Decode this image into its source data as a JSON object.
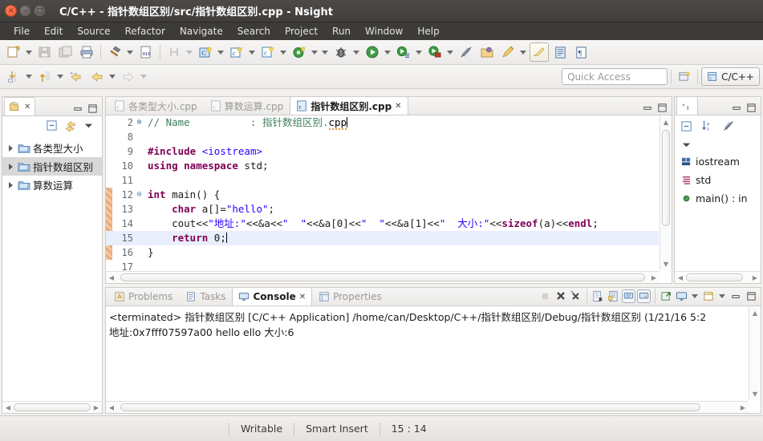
{
  "window": {
    "title": "C/C++ - 指针数组区别/src/指针数组区别.cpp - Nsight",
    "close_label": "✕",
    "minimize_label": "–",
    "maximize_label": "□"
  },
  "menubar": {
    "items": [
      {
        "label": "File"
      },
      {
        "label": "Edit"
      },
      {
        "label": "Source"
      },
      {
        "label": "Refactor"
      },
      {
        "label": "Navigate"
      },
      {
        "label": "Search"
      },
      {
        "label": "Project"
      },
      {
        "label": "Run"
      },
      {
        "label": "Window"
      },
      {
        "label": "Help"
      }
    ]
  },
  "toolbar": {
    "quick_access_placeholder": "Quick Access",
    "perspective_label": "C/C++"
  },
  "project_explorer": {
    "tab_label": "",
    "items": [
      {
        "label": "各类型大小",
        "selected": false
      },
      {
        "label": "指针数组区别",
        "selected": true
      },
      {
        "label": "算数运算",
        "selected": false
      }
    ]
  },
  "editor": {
    "tabs": [
      {
        "label": "各类型大小.cpp",
        "active": false
      },
      {
        "label": "算数运算.cpp",
        "active": false
      },
      {
        "label": "指针数组区别.cpp",
        "active": true,
        "close_label": "✕"
      }
    ],
    "lines": [
      {
        "num": "2",
        "fold": "⊕",
        "highlight": false,
        "changed": false,
        "tokens": [
          {
            "t": "// Name          : ",
            "c": "cmt"
          },
          {
            "t": "指针数组区别.",
            "c": "cmt-cn"
          },
          {
            "t": "cpp",
            "c": "spell"
          },
          {
            "t": "",
            "c": "caret"
          }
        ]
      },
      {
        "num": "8",
        "fold": "",
        "highlight": false,
        "changed": false,
        "tokens": []
      },
      {
        "num": "9",
        "fold": "",
        "highlight": false,
        "changed": false,
        "tokens": [
          {
            "t": "#include ",
            "c": "pre"
          },
          {
            "t": "<iostream>",
            "c": "inc"
          }
        ]
      },
      {
        "num": "10",
        "fold": "",
        "highlight": false,
        "changed": false,
        "tokens": [
          {
            "t": "using namespace ",
            "c": "kw"
          },
          {
            "t": "std;",
            "c": "plain"
          }
        ]
      },
      {
        "num": "11",
        "fold": "",
        "highlight": false,
        "changed": false,
        "tokens": []
      },
      {
        "num": "12",
        "fold": "⊖",
        "highlight": false,
        "changed": true,
        "tokens": [
          {
            "t": "int",
            "c": "kw"
          },
          {
            "t": " main() {",
            "c": "plain"
          }
        ]
      },
      {
        "num": "13",
        "fold": "",
        "highlight": false,
        "changed": true,
        "tokens": [
          {
            "t": "    ",
            "c": "plain"
          },
          {
            "t": "char",
            "c": "kw"
          },
          {
            "t": " a[]=",
            "c": "plain"
          },
          {
            "t": "\"hello\"",
            "c": "str"
          },
          {
            "t": ";",
            "c": "plain"
          }
        ]
      },
      {
        "num": "14",
        "fold": "",
        "highlight": false,
        "changed": true,
        "tokens": [
          {
            "t": "    cout<<",
            "c": "plain"
          },
          {
            "t": "\"",
            "c": "str"
          },
          {
            "t": "地址:",
            "c": "str"
          },
          {
            "t": "\"",
            "c": "str"
          },
          {
            "t": "<<&a<<",
            "c": "plain"
          },
          {
            "t": "\"  \"",
            "c": "str"
          },
          {
            "t": "<<&a[0]<<",
            "c": "plain"
          },
          {
            "t": "\"  \"",
            "c": "str"
          },
          {
            "t": "<<&a[1]<<",
            "c": "plain"
          },
          {
            "t": "\"  ",
            "c": "str"
          },
          {
            "t": "大小:",
            "c": "str"
          },
          {
            "t": "\"",
            "c": "str"
          },
          {
            "t": "<<",
            "c": "plain"
          },
          {
            "t": "sizeof",
            "c": "kw"
          },
          {
            "t": "(a)<<",
            "c": "plain"
          },
          {
            "t": "endl",
            "c": "kw"
          },
          {
            "t": ";",
            "c": "plain"
          }
        ]
      },
      {
        "num": "15",
        "fold": "",
        "highlight": true,
        "changed": true,
        "tokens": [
          {
            "t": "    ",
            "c": "plain"
          },
          {
            "t": "return",
            "c": "kw"
          },
          {
            "t": " 0;",
            "c": "plain"
          },
          {
            "t": "",
            "c": "caret"
          }
        ]
      },
      {
        "num": "16",
        "fold": "",
        "highlight": false,
        "changed": true,
        "tokens": [
          {
            "t": "}",
            "c": "plain"
          }
        ]
      },
      {
        "num": "17",
        "fold": "",
        "highlight": false,
        "changed": false,
        "tokens": []
      }
    ]
  },
  "outline": {
    "items": [
      {
        "label": "iostream",
        "icon": "include-icon"
      },
      {
        "label": "std",
        "icon": "namespace-icon"
      },
      {
        "label": "main() : in",
        "icon": "function-icon"
      }
    ]
  },
  "console": {
    "tabs": [
      {
        "label": "Problems",
        "active": false,
        "icon": "problems-icon"
      },
      {
        "label": "Tasks",
        "active": false,
        "icon": "tasks-icon"
      },
      {
        "label": "Console",
        "active": true,
        "icon": "console-icon",
        "close_label": "✕"
      },
      {
        "label": "Properties",
        "active": false,
        "icon": "properties-icon"
      }
    ],
    "output_lines": [
      "<terminated> 指针数组区别 [C/C++ Application] /home/can/Desktop/C++/指针数组区别/Debug/指针数组区别 (1/21/16 5:2",
      "地址:0x7fff07597a00   hello   ello   大小:6"
    ]
  },
  "statusbar": {
    "writable": "Writable",
    "insert_mode": "Smart Insert",
    "position": "15 : 14"
  },
  "colors": {
    "titlebar": "#413e3c",
    "accent_selection": "#e8eefb",
    "keyword": "#7f0055",
    "string": "#2a00ff",
    "comment": "#3f7f5f",
    "changebar": "#eaa876"
  }
}
